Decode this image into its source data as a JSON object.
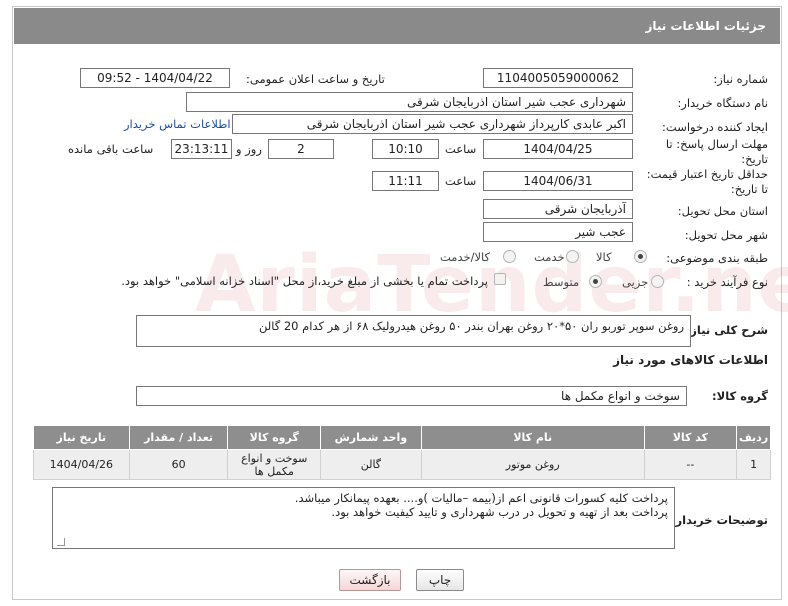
{
  "header": {
    "title": "جزئیات اطلاعات نیاز"
  },
  "fields": {
    "need_number_label": "شماره نیاز:",
    "need_number": "1104005059000062",
    "announce_label": "تاریخ و ساعت اعلان عمومی:",
    "announce_value": "1404/04/22 - 09:52",
    "buyer_label": "نام دستگاه خریدار:",
    "buyer_value": "شهرداری عجب شیر استان اذربایجان شرقی",
    "creator_label": "ایجاد کننده درخواست:",
    "creator_value": "اکبر عابدی کارپرداز شهرداری عجب شیر استان اذربایجان شرقی",
    "contact_link": "اطلاعات تماس خریدار",
    "deadline_label_1": "مهلت ارسال پاسخ: تا",
    "deadline_label_2": "تاریخ:",
    "deadline_date": "1404/04/25",
    "time_label": "ساعت",
    "deadline_time": "10:10",
    "days_value": "2",
    "days_label": "روز و",
    "remaining_time": "23:13:11",
    "remaining_label": "ساعت باقی مانده",
    "validity_label_1": "حداقل تاریخ اعتبار قیمت:",
    "validity_label_2": "تا تاریخ:",
    "validity_date": "1404/06/31",
    "validity_time": "11:11",
    "province_label": "استان محل تحویل:",
    "province_value": "آذربایجان شرقی",
    "city_label": "شهر محل تحویل:",
    "city_value": "عجب شیر",
    "category_label": "طبقه بندی موضوعی:",
    "category_options": [
      "کالا",
      "خدمت",
      "کالا/خدمت"
    ],
    "process_label": "نوع فرآیند خرید :",
    "process_options": [
      "جزیی",
      "متوسط"
    ],
    "payment_note": "پرداخت تمام یا بخشی از مبلغ خرید،از محل \"اسناد خزانه اسلامی\" خواهد بود."
  },
  "description": {
    "label": "شرح کلی نیاز:",
    "text": "روغن سوپر توربو ران ۵۰*۲۰          روغن بهران بندر ۵۰          روغن  هیدرولیک ۶۸       از هر کدام 20 گالن"
  },
  "goods": {
    "section_title": "اطلاعات کالاهای مورد نیاز",
    "group_label": "گروه کالا:",
    "group_value": "سوخت و انواع مکمل ها",
    "columns": [
      "ردیف",
      "کد کالا",
      "نام کالا",
      "واحد شمارش",
      "گروه کالا",
      "تعداد / مقدار",
      "تاریخ نیاز"
    ],
    "rows": [
      [
        "1",
        "--",
        "روغن موتور",
        "گالن",
        "سوخت و انواع مکمل ها",
        "60",
        "1404/04/26"
      ]
    ]
  },
  "buyer_notes": {
    "label": "توضیحات خریدار:",
    "line1": "پرداخت کلیه کسورات قانونی اعم از(بیمه –مالیات )و.... بعهده پیمانکار میباشد.",
    "line2": "پرداخت بعد از تهیه و تحویل در درب شهرداری  و تایید کیفیت خواهد بود."
  },
  "buttons": {
    "print": "چاپ",
    "back": "بازگشت"
  },
  "watermark_text": "AriaTender.neT"
}
